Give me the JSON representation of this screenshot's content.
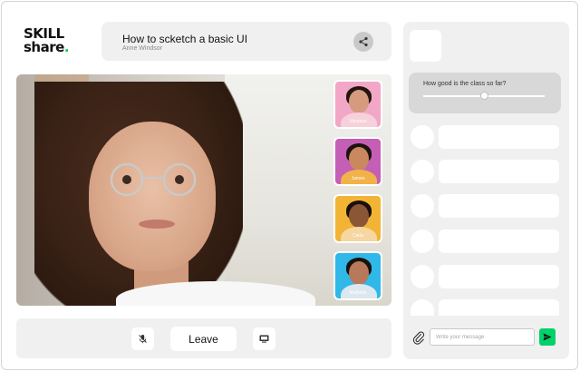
{
  "brand": {
    "logo_line1": "SKILL",
    "logo_line2": "share",
    "logo_dot": ".",
    "accent_color": "#00d26a"
  },
  "header": {
    "title": "How to scketch a basic UI",
    "author": "Anne  Windsor",
    "share_icon": "share-icon"
  },
  "participants": [
    {
      "name": "Vanessa",
      "bg": "#f2a7c6",
      "shirt": "#f6d0da",
      "skin": "#d59b7e",
      "hair": "#251511"
    },
    {
      "name": "James",
      "bg": "#c55fb5",
      "shirt": "#f1b24a",
      "skin": "#c9885f",
      "hair": "#1d120d"
    },
    {
      "name": "Carla",
      "bg": "#f2b435",
      "shirt": "#f6d7a1",
      "skin": "#8a5636",
      "hair": "#1a100b"
    },
    {
      "name": "Mathilda",
      "bg": "#2fb8e8",
      "shirt": "#dce7ef",
      "skin": "#b7795a",
      "hair": "#1b110c"
    }
  ],
  "controls": {
    "mic_icon": "mic-off-icon",
    "leave_label": "Leave",
    "screen_icon": "screen-share-icon"
  },
  "poll": {
    "question": "How good is the class so far?",
    "value": 0.5
  },
  "chat": {
    "placeholder": "Write your message",
    "attach_icon": "paperclip-icon",
    "send_icon": "send-icon"
  }
}
